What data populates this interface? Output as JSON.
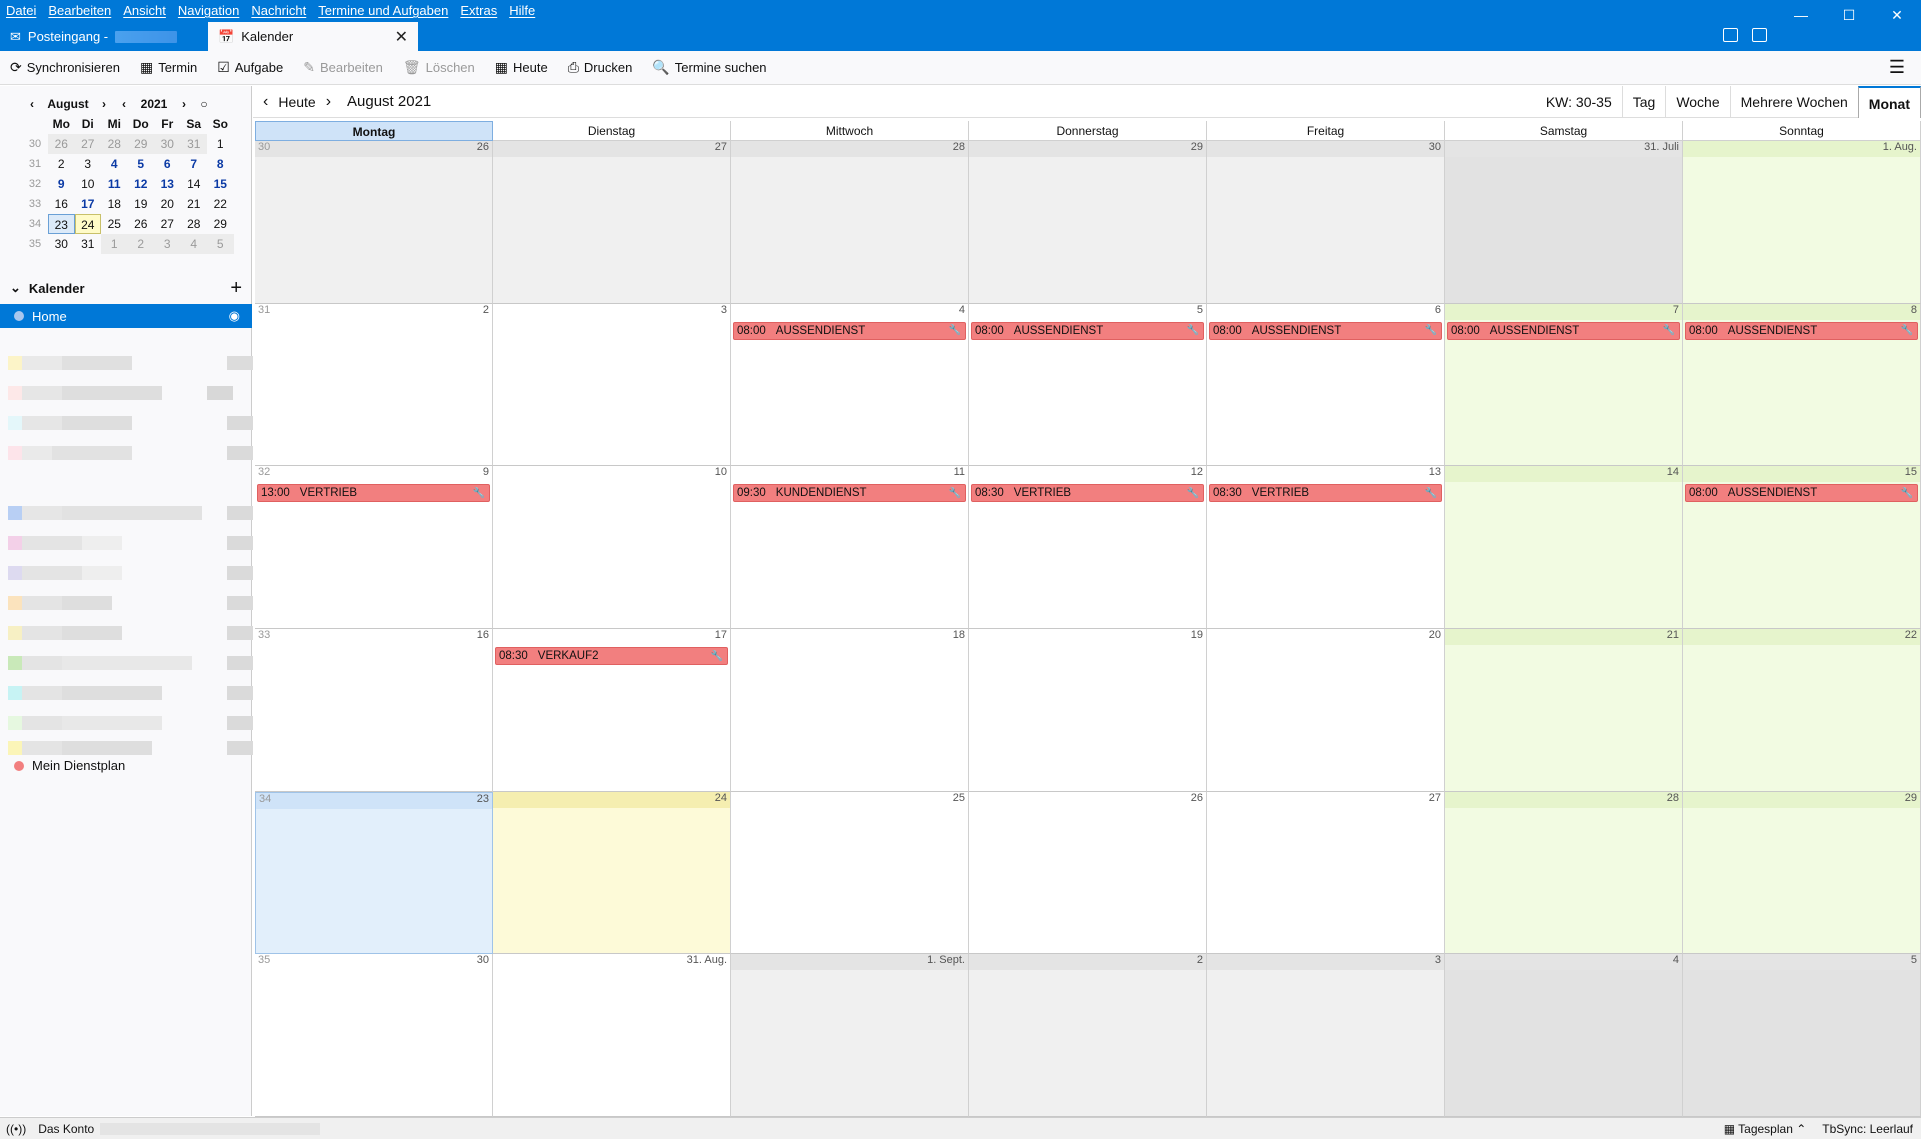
{
  "menu": [
    "Datei",
    "Bearbeiten",
    "Ansicht",
    "Navigation",
    "Nachricht",
    "Termine und Aufgaben",
    "Extras",
    "Hilfe"
  ],
  "tabs": {
    "inbox": "Posteingang -",
    "calendar": "Kalender"
  },
  "toolbar": {
    "sync": "Synchronisieren",
    "event": "Termin",
    "task": "Aufgabe",
    "edit": "Bearbeiten",
    "delete": "Löschen",
    "today": "Heute",
    "print": "Drucken",
    "find": "Termine suchen"
  },
  "minical": {
    "month": "August",
    "year": "2021",
    "weekdays": [
      "Mo",
      "Di",
      "Mi",
      "Do",
      "Fr",
      "Sa",
      "So"
    ],
    "weeks": [
      {
        "wk": "30",
        "days": [
          {
            "d": "26",
            "t": "other"
          },
          {
            "d": "27",
            "t": "other"
          },
          {
            "d": "28",
            "t": "other"
          },
          {
            "d": "29",
            "t": "other"
          },
          {
            "d": "30",
            "t": "other"
          },
          {
            "d": "31",
            "t": "other"
          },
          {
            "d": "1",
            "t": ""
          }
        ]
      },
      {
        "wk": "31",
        "days": [
          {
            "d": "2",
            "t": ""
          },
          {
            "d": "3",
            "t": ""
          },
          {
            "d": "4",
            "t": "bold"
          },
          {
            "d": "5",
            "t": "bold"
          },
          {
            "d": "6",
            "t": "bold"
          },
          {
            "d": "7",
            "t": "bold"
          },
          {
            "d": "8",
            "t": "bold"
          }
        ]
      },
      {
        "wk": "32",
        "days": [
          {
            "d": "9",
            "t": "bold"
          },
          {
            "d": "10",
            "t": ""
          },
          {
            "d": "11",
            "t": "bold"
          },
          {
            "d": "12",
            "t": "bold"
          },
          {
            "d": "13",
            "t": "bold"
          },
          {
            "d": "14",
            "t": ""
          },
          {
            "d": "15",
            "t": "bold"
          }
        ]
      },
      {
        "wk": "33",
        "days": [
          {
            "d": "16",
            "t": ""
          },
          {
            "d": "17",
            "t": "bold"
          },
          {
            "d": "18",
            "t": ""
          },
          {
            "d": "19",
            "t": ""
          },
          {
            "d": "20",
            "t": ""
          },
          {
            "d": "21",
            "t": ""
          },
          {
            "d": "22",
            "t": ""
          }
        ]
      },
      {
        "wk": "34",
        "days": [
          {
            "d": "23",
            "t": "sel"
          },
          {
            "d": "24",
            "t": "today"
          },
          {
            "d": "25",
            "t": ""
          },
          {
            "d": "26",
            "t": ""
          },
          {
            "d": "27",
            "t": ""
          },
          {
            "d": "28",
            "t": ""
          },
          {
            "d": "29",
            "t": ""
          }
        ]
      },
      {
        "wk": "35",
        "days": [
          {
            "d": "30",
            "t": ""
          },
          {
            "d": "31",
            "t": ""
          },
          {
            "d": "1",
            "t": "other"
          },
          {
            "d": "2",
            "t": "other"
          },
          {
            "d": "3",
            "t": "other"
          },
          {
            "d": "4",
            "t": "other"
          },
          {
            "d": "5",
            "t": "other"
          }
        ]
      }
    ]
  },
  "calendars": {
    "header": "Kalender",
    "home": "Home",
    "dienstplan": "Mein Dienstplan"
  },
  "nav": {
    "today": "Heute",
    "title": "August 2021"
  },
  "views": {
    "kw": "KW: 30-35",
    "day": "Tag",
    "week": "Woche",
    "multiweek": "Mehrere Wochen",
    "month": "Monat"
  },
  "weekdays_full": [
    "Montag",
    "Dienstag",
    "Mittwoch",
    "Donnerstag",
    "Freitag",
    "Samstag",
    "Sonntag"
  ],
  "month_grid": [
    {
      "wk": "30",
      "days": [
        {
          "d": "26",
          "c": "other"
        },
        {
          "d": "27",
          "c": "other"
        },
        {
          "d": "28",
          "c": "other"
        },
        {
          "d": "29",
          "c": "other"
        },
        {
          "d": "30",
          "c": "other"
        },
        {
          "d": "31. Juli",
          "c": "otherweekend"
        },
        {
          "d": "1. Aug.",
          "c": "weekend"
        }
      ]
    },
    {
      "wk": "31",
      "days": [
        {
          "d": "2",
          "c": ""
        },
        {
          "d": "3",
          "c": ""
        },
        {
          "d": "4",
          "c": "",
          "ev": {
            "time": "08:00",
            "title": "AUSSENDIENST"
          }
        },
        {
          "d": "5",
          "c": "",
          "ev": {
            "time": "08:00",
            "title": "AUSSENDIENST"
          }
        },
        {
          "d": "6",
          "c": "",
          "ev": {
            "time": "08:00",
            "title": "AUSSENDIENST"
          }
        },
        {
          "d": "7",
          "c": "weekend",
          "ev": {
            "time": "08:00",
            "title": "AUSSENDIENST"
          }
        },
        {
          "d": "8",
          "c": "weekend",
          "ev": {
            "time": "08:00",
            "title": "AUSSENDIENST"
          }
        }
      ]
    },
    {
      "wk": "32",
      "days": [
        {
          "d": "9",
          "c": "",
          "ev": {
            "time": "13:00",
            "title": "VERTRIEB"
          }
        },
        {
          "d": "10",
          "c": ""
        },
        {
          "d": "11",
          "c": "",
          "ev": {
            "time": "09:30",
            "title": "KUNDENDIENST"
          }
        },
        {
          "d": "12",
          "c": "",
          "ev": {
            "time": "08:30",
            "title": "VERTRIEB"
          }
        },
        {
          "d": "13",
          "c": "",
          "ev": {
            "time": "08:30",
            "title": "VERTRIEB"
          }
        },
        {
          "d": "14",
          "c": "weekend"
        },
        {
          "d": "15",
          "c": "weekend",
          "ev": {
            "time": "08:00",
            "title": "AUSSENDIENST"
          }
        }
      ]
    },
    {
      "wk": "33",
      "days": [
        {
          "d": "16",
          "c": ""
        },
        {
          "d": "17",
          "c": "",
          "ev": {
            "time": "08:30",
            "title": "VERKAUF2"
          }
        },
        {
          "d": "18",
          "c": ""
        },
        {
          "d": "19",
          "c": ""
        },
        {
          "d": "20",
          "c": ""
        },
        {
          "d": "21",
          "c": "weekend"
        },
        {
          "d": "22",
          "c": "weekend"
        }
      ]
    },
    {
      "wk": "34",
      "days": [
        {
          "d": "23",
          "c": "sel"
        },
        {
          "d": "24",
          "c": "today"
        },
        {
          "d": "25",
          "c": ""
        },
        {
          "d": "26",
          "c": ""
        },
        {
          "d": "27",
          "c": ""
        },
        {
          "d": "28",
          "c": "weekend"
        },
        {
          "d": "29",
          "c": "weekend"
        }
      ]
    },
    {
      "wk": "35",
      "days": [
        {
          "d": "30",
          "c": ""
        },
        {
          "d": "31. Aug.",
          "c": ""
        },
        {
          "d": "1. Sept.",
          "c": "other"
        },
        {
          "d": "2",
          "c": "other"
        },
        {
          "d": "3",
          "c": "other"
        },
        {
          "d": "4",
          "c": "otherweekend"
        },
        {
          "d": "5",
          "c": "otherweekend"
        }
      ]
    }
  ],
  "status": {
    "account": "Das Konto",
    "agenda": "Tagesplan",
    "tbsync": "TbSync: Leerlauf"
  },
  "colors": {
    "accent": "#0078d7",
    "event": "#f27f7f",
    "weekend": "#f2fbe2",
    "today": "#fdfad8",
    "selected": "#e2effb"
  },
  "icons": {
    "sync": "sync-icon",
    "event": "calendar-event-icon",
    "task": "task-icon",
    "edit": "pencil-icon",
    "delete": "trash-icon",
    "print": "printer-icon",
    "find": "search-icon",
    "wrench": "wrench-icon"
  }
}
